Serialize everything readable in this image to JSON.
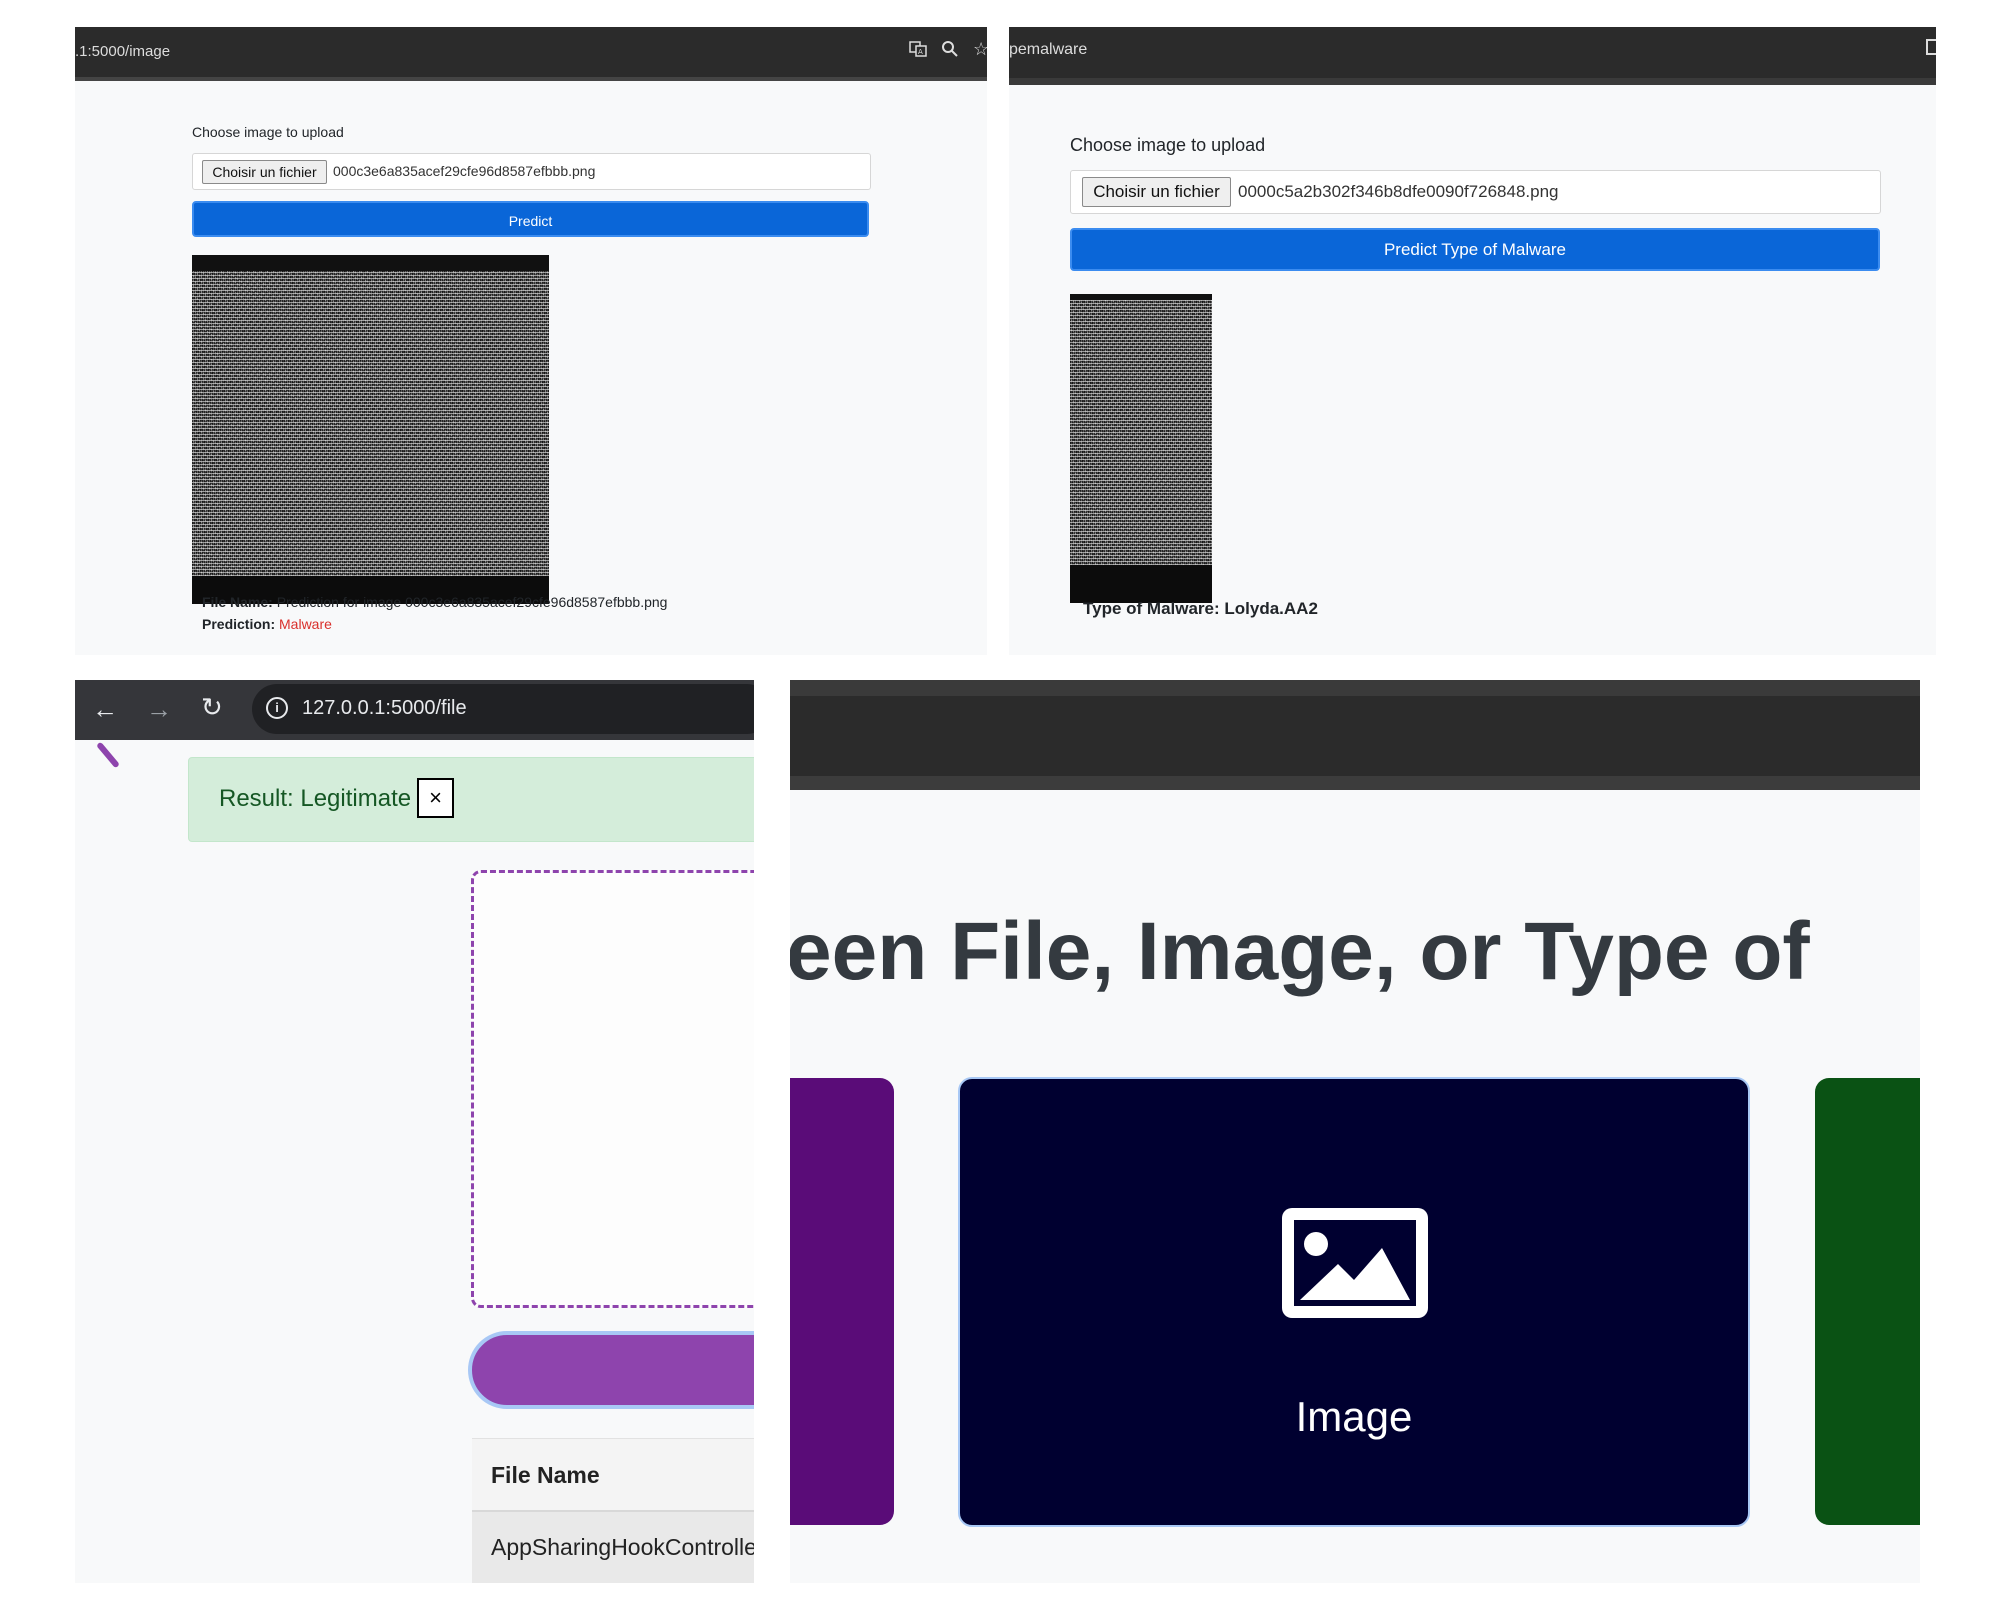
{
  "panel1": {
    "url": ".1:5000/image",
    "label": "Choose image to upload",
    "file_button": "Choisir un fichier",
    "file_name": "000c3e6a835acef29cfe96d8587efbbb.png",
    "predict_button": "Predict",
    "result_filename_label": "File Name:",
    "result_filename_value": "Prediction for image 000c3e6a835acef29cfe96d8587efbbb.png",
    "prediction_label": "Prediction:",
    "prediction_value": "Malware",
    "colors": {
      "accent": "#0a66d8",
      "malware": "#d9302c"
    }
  },
  "panel2": {
    "url": "pemalware",
    "label": "Choose image to upload",
    "file_button": "Choisir un fichier",
    "file_name": "0000c5a2b302f346b8dfe0090f726848.png",
    "predict_button": "Predict Type of Malware",
    "result": "Type of Malware: Lolyda.AA2"
  },
  "panel3": {
    "url": "127.0.0.1:5000/file",
    "alert_text": "Result: Legitimate",
    "close_symbol": "×",
    "table_header": "File Name",
    "table_row": "AppSharingHookControlle",
    "colors": {
      "alert_bg": "#d4edda",
      "alert_text": "#155724",
      "purple": "#8e44ad"
    }
  },
  "panel4": {
    "heading": "een File, Image, or Type of",
    "card_label": "Image",
    "colors": {
      "left_card": "#5a0c78",
      "center_card": "#000030",
      "right_card": "#0a5214"
    }
  }
}
